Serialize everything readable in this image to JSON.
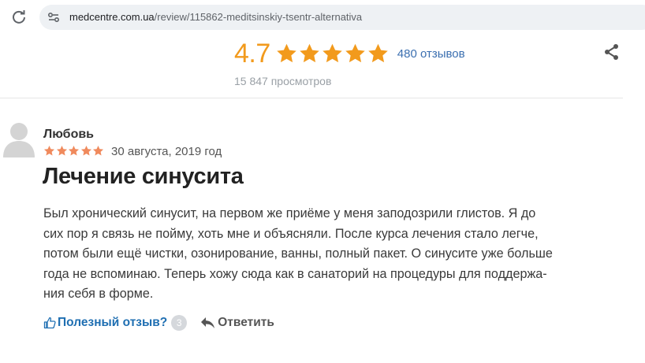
{
  "browser": {
    "url_domain": "medcentre.com.ua",
    "url_path": "/review/115862-meditsinskiy-tsentr-alternativa"
  },
  "rating_header": {
    "score": "4.7",
    "stars": 5,
    "star_color": "#f29a1c",
    "reviews_count_label": "480 отзывов",
    "views_label": "15 847 просмотров"
  },
  "review": {
    "author": "Любовь",
    "stars": 5,
    "star_color": "#f08a5d",
    "date": "30 августа, 2019 год",
    "title": "Лечение синусита",
    "body_lines": [
      "Был хронический синусит, на первом же приёме у меня заподозрили глистов. Я до",
      "сих пор я связь не пойму, хоть мне и объясняли. После курса лечения стало легче,",
      "потом были ещё чистки, озонирование, ванны, полный пакет. О синусите уже больше",
      "года не вспоминаю. Теперь хожу сюда как в санаторий на процедуры для поддержа-",
      "ния себя в форме."
    ],
    "helpful_label": "Полезный отзыв?",
    "helpful_count": "3",
    "reply_label": "Ответить"
  },
  "icons": [
    "reload-icon",
    "site-info-icon",
    "star-icon",
    "share-icon",
    "avatar-icon",
    "thumbs-up-icon",
    "reply-arrow-icon"
  ]
}
